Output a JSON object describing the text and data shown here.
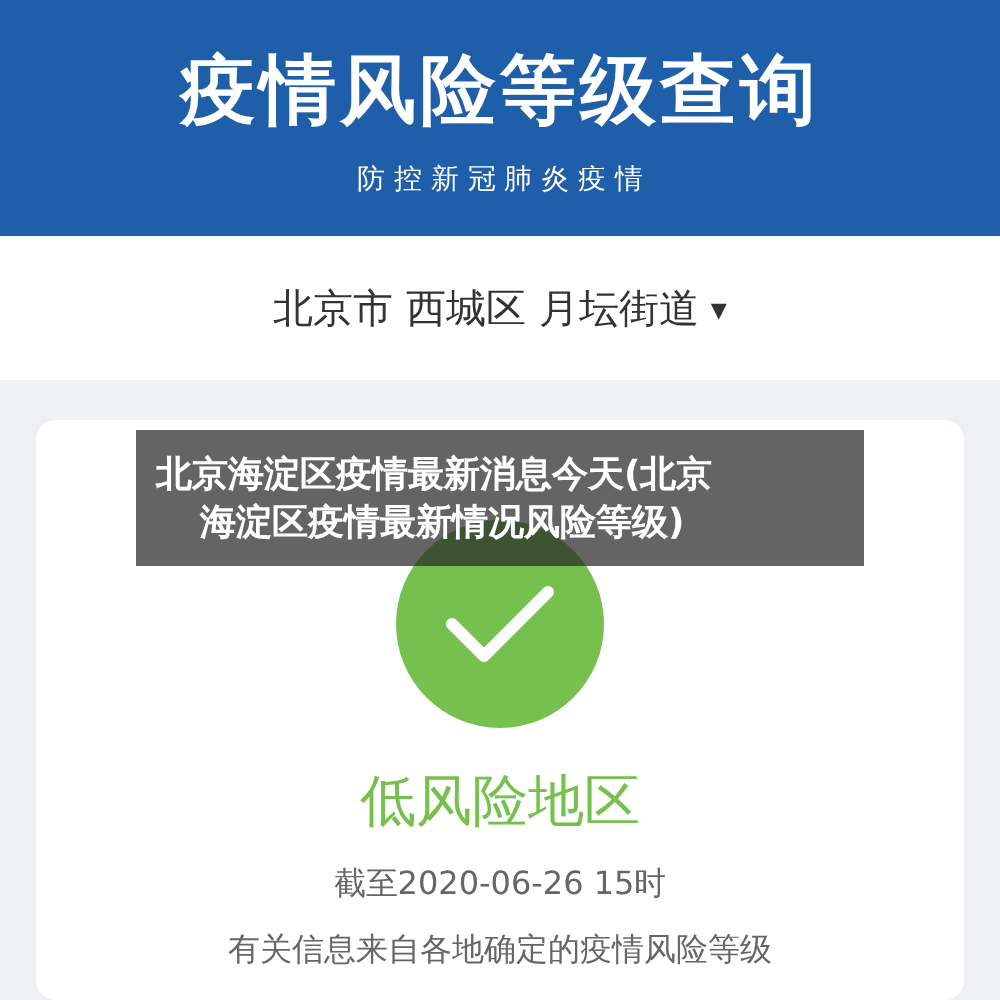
{
  "header": {
    "title": "疫情风险等级查询",
    "subtitle": "防 控 新 冠 肺 炎 疫 情"
  },
  "location": {
    "text": "北京市 西城区 月坛街道",
    "caret": "▾"
  },
  "result": {
    "kind": "low",
    "label": "低风险地区",
    "updated": "截至2020-06-26 15时",
    "note": "有关信息来自各地确定的疫情风险等级"
  },
  "caption": {
    "lines": [
      "北京海淀区疫情最新消息今天(北京",
      "海淀区疫情最新情况风险等级)"
    ]
  }
}
